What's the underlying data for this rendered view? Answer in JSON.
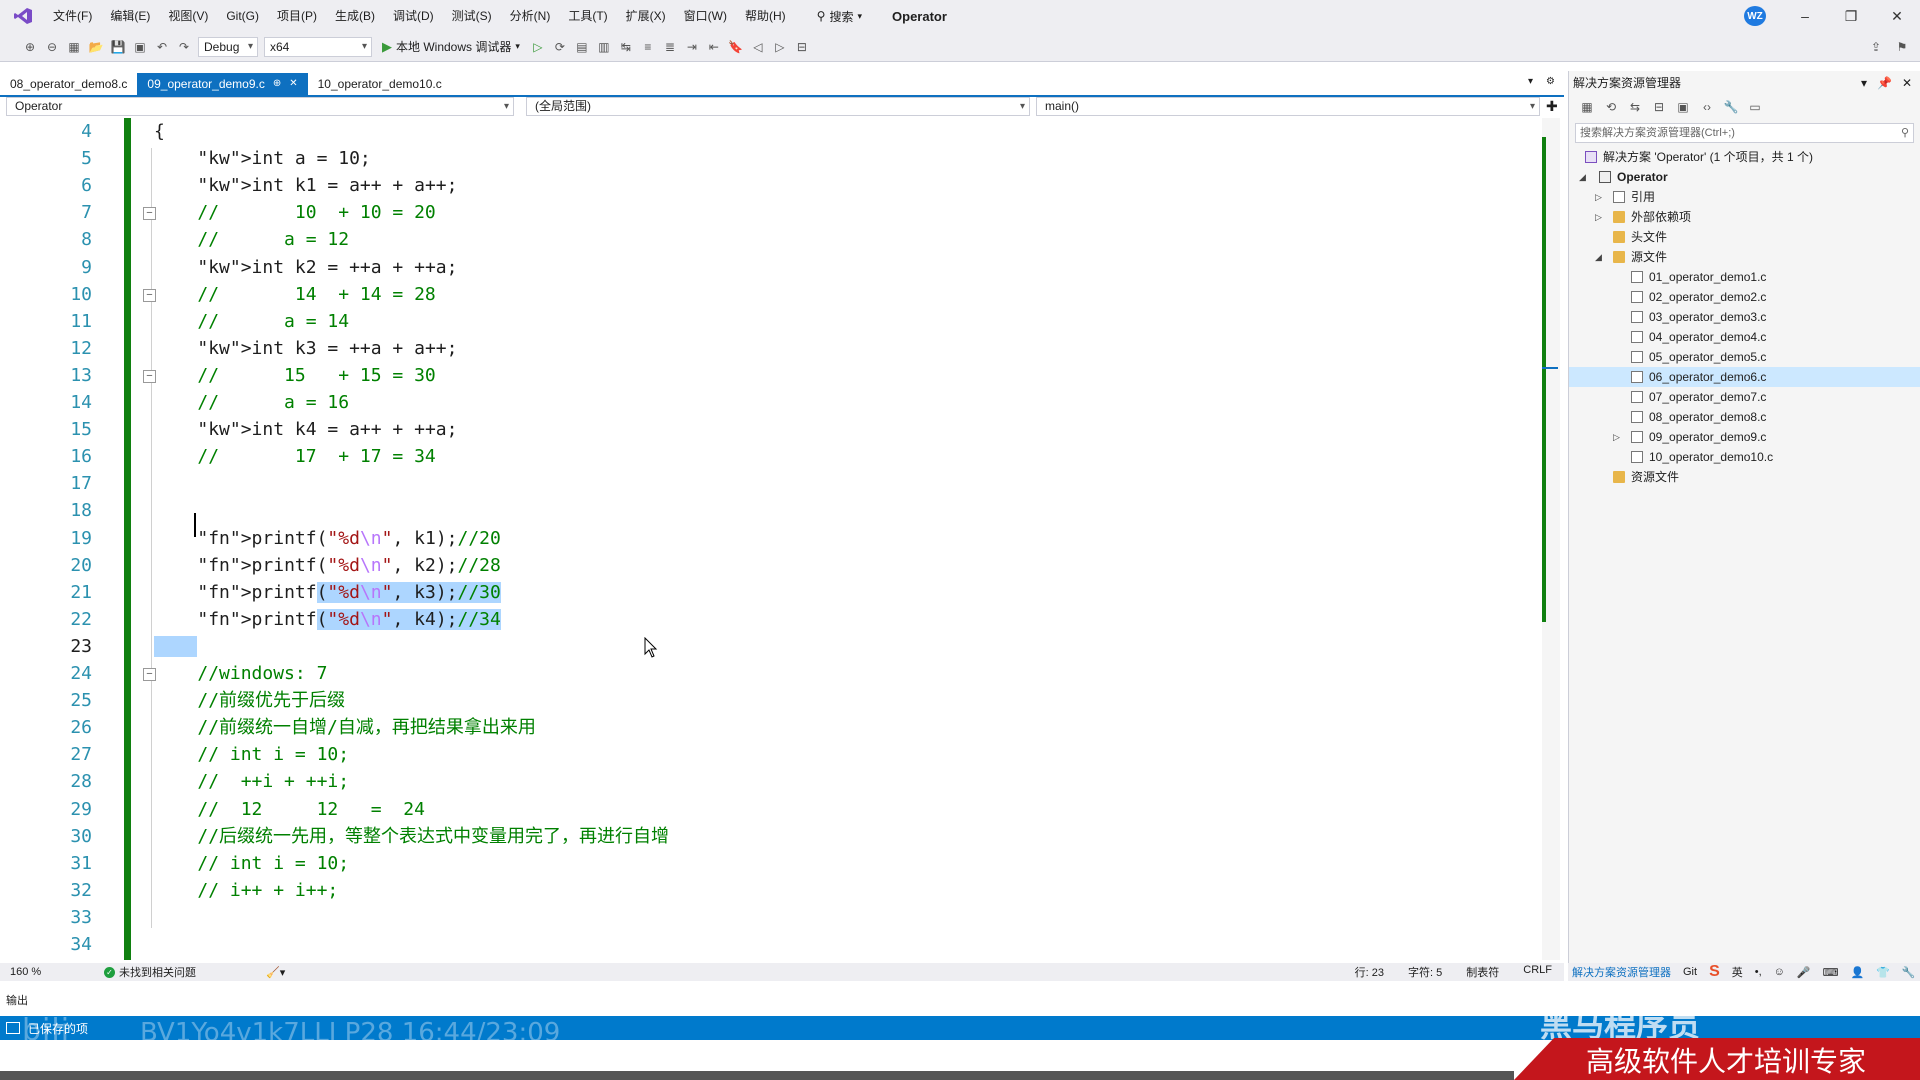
{
  "menubar": {
    "items": [
      "文件(F)",
      "编辑(E)",
      "视图(V)",
      "Git(G)",
      "项目(P)",
      "生成(B)",
      "调试(D)",
      "测试(S)",
      "分析(N)",
      "工具(T)",
      "扩展(X)",
      "窗口(W)",
      "帮助(H)"
    ],
    "search_label": "搜索",
    "solution_title": "Operator",
    "avatar_initials": "WZ"
  },
  "toolbar": {
    "config": "Debug",
    "platform": "x64",
    "run_label": "本地 Windows 调试器"
  },
  "tabs": [
    {
      "label": "08_operator_demo8.c",
      "active": false
    },
    {
      "label": "09_operator_demo9.c",
      "active": true
    },
    {
      "label": "10_operator_demo10.c",
      "active": false
    }
  ],
  "navbar": {
    "project": "Operator",
    "scope": "(全局范围)",
    "member": "main()"
  },
  "editor": {
    "lines": [
      {
        "n": "4",
        "code": "{"
      },
      {
        "n": "5",
        "code": "    int a = 10;"
      },
      {
        "n": "6",
        "code": "    int k1 = a++ + a++;"
      },
      {
        "n": "7",
        "code": "    //       10  + 10 = 20"
      },
      {
        "n": "8",
        "code": "    //      a = 12"
      },
      {
        "n": "9",
        "code": "    int k2 = ++a + ++a;"
      },
      {
        "n": "10",
        "code": "    //       14  + 14 = 28"
      },
      {
        "n": "11",
        "code": "    //      a = 14"
      },
      {
        "n": "12",
        "code": "    int k3 = ++a + a++;"
      },
      {
        "n": "13",
        "code": "    //      15   + 15 = 30"
      },
      {
        "n": "14",
        "code": "    //      a = 16"
      },
      {
        "n": "15",
        "code": "    int k4 = a++ + ++a;"
      },
      {
        "n": "16",
        "code": "    //       17  + 17 = 34"
      },
      {
        "n": "17",
        "code": ""
      },
      {
        "n": "18",
        "code": ""
      },
      {
        "n": "19",
        "code": "    printf(\"%d\\n\", k1);//20"
      },
      {
        "n": "20",
        "code": "    printf(\"%d\\n\", k2);//28"
      },
      {
        "n": "21",
        "code": "    printf(\"%d\\n\", k3);//30"
      },
      {
        "n": "22",
        "code": "    printf(\"%d\\n\", k4);//34"
      },
      {
        "n": "23",
        "code": ""
      },
      {
        "n": "24",
        "code": "    //windows: 7"
      },
      {
        "n": "25",
        "code": "    //前缀优先于后缀"
      },
      {
        "n": "26",
        "code": "    //前缀统一自增/自减，再把结果拿出来用"
      },
      {
        "n": "27",
        "code": "    // int i = 10;"
      },
      {
        "n": "28",
        "code": "    //  ++i + ++i;"
      },
      {
        "n": "29",
        "code": "    //  12     12   =  24"
      },
      {
        "n": "30",
        "code": "    //后缀统一先用，等整个表达式中变量用完了，再进行自增"
      },
      {
        "n": "31",
        "code": "    // int i = 10;"
      },
      {
        "n": "32",
        "code": "    // i++ + i++;"
      },
      {
        "n": "33",
        "code": ""
      },
      {
        "n": "34",
        "code": ""
      }
    ],
    "current_line": "23"
  },
  "editor_status": {
    "zoom": "160 %",
    "issues": "未找到相关问题",
    "line": "行: 23",
    "char": "字符: 5",
    "indent": "制表符",
    "eol": "CRLF"
  },
  "solution_explorer": {
    "title": "解决方案资源管理器",
    "search_placeholder": "搜索解决方案资源管理器(Ctrl+;)",
    "solution": "解决方案 'Operator' (1 个项目，共 1 个)",
    "project": "Operator",
    "references": "引用",
    "external_deps": "外部依赖项",
    "header_files": "头文件",
    "source_files": "源文件",
    "files": [
      "01_operator_demo1.c",
      "02_operator_demo2.c",
      "03_operator_demo3.c",
      "04_operator_demo4.c",
      "05_operator_demo5.c",
      "06_operator_demo6.c",
      "07_operator_demo7.c",
      "08_operator_demo8.c",
      "09_operator_demo9.c",
      "10_operator_demo10.c"
    ],
    "selected_file": "06_operator_demo6.c",
    "resource_files": "资源文件",
    "bottom_tab_sol": "解决方案资源管理器",
    "bottom_tab_git": "Git"
  },
  "output_label": "输出",
  "statusbar": {
    "text": "已保存的项"
  },
  "overlay": {
    "video_id": "BV1Yo4v1k7LLI P28 16:44/23:09",
    "brand": "黑马程序员",
    "slogan": "高级软件人才培训专家"
  },
  "colors": {
    "accent": "#0e70c0",
    "keyword": "#0000ff",
    "comment": "#008000",
    "string": "#a31515",
    "change_bar": "#108010",
    "selection": "#add6ff",
    "statusbar": "#007acc"
  }
}
